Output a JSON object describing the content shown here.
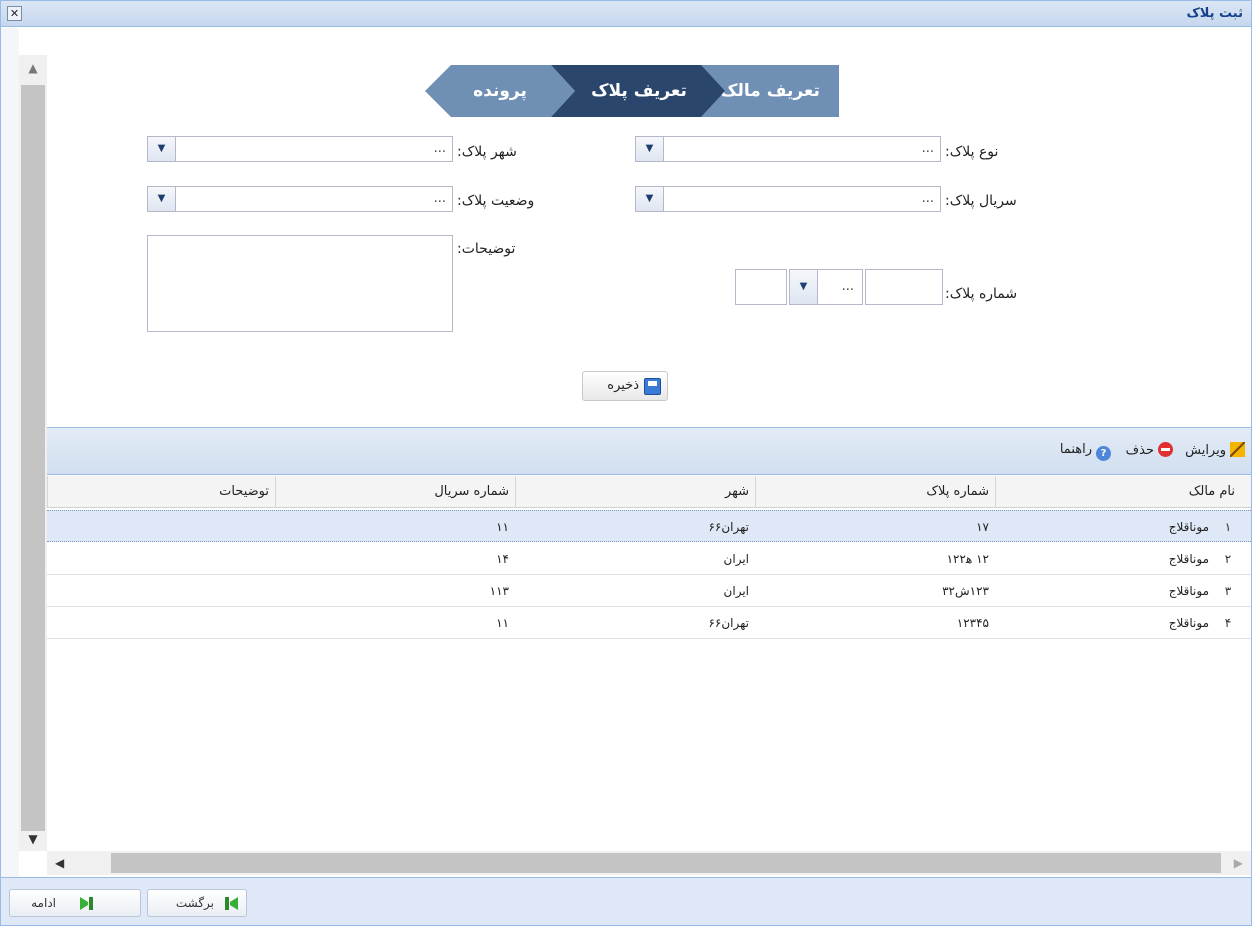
{
  "window": {
    "title": "ثبت پلاک",
    "close_symbol": "✕"
  },
  "steps": [
    {
      "label": "تعریف مالک"
    },
    {
      "label": "تعریف پلاک"
    },
    {
      "label": "پرونده"
    }
  ],
  "form": {
    "plate_type_label": "نوع پلاک:",
    "plate_type_value": "...",
    "plate_city_label": "شهر پلاک:",
    "plate_city_value": "...",
    "plate_serial_label": "سریال پلاک:",
    "plate_serial_value": "...",
    "plate_status_label": "وضعیت پلاک:",
    "plate_status_value": "...",
    "description_label": "توضیحات:",
    "plate_number_label": "شماره پلاک:",
    "plate_letter_value": "...",
    "save_label": "ذخیره"
  },
  "toolbar": {
    "edit_label": "ویرایش",
    "delete_label": "حذف",
    "help_label": "راهنما"
  },
  "grid": {
    "columns": [
      "نام مالک",
      "شماره پلاک",
      "شهر",
      "شماره سریال",
      "توضیحات"
    ],
    "rows": [
      {
        "index": "۱",
        "owner": "موناقلاج",
        "plate": "۱۷",
        "city": "تهران۶۶",
        "serial": "۱۱",
        "desc": ""
      },
      {
        "index": "۲",
        "owner": "موناقلاج",
        "plate": "۱۲ ﻫ۱۲۲",
        "city": "ایران",
        "serial": "۱۴",
        "desc": ""
      },
      {
        "index": "۳",
        "owner": "موناقلاج",
        "plate": "۱۲۳ش۳۲",
        "city": "ایران",
        "serial": "۱۱۳",
        "desc": ""
      },
      {
        "index": "۴",
        "owner": "موناقلاج",
        "plate": "۱۲۳۴۵",
        "city": "تهران۶۶",
        "serial": "۱۱",
        "desc": ""
      }
    ]
  },
  "footer": {
    "back_label": "برگشت",
    "continue_label": "ادامه"
  }
}
